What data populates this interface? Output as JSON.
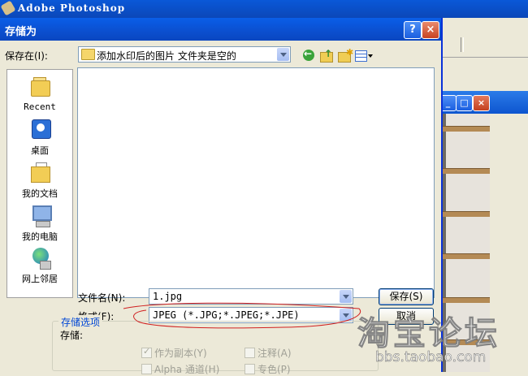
{
  "app": {
    "title": "Adobe Photoshop"
  },
  "dialog": {
    "title": "存储为",
    "help_glyph": "?",
    "close_glyph": "×",
    "save_in_label": "保存在(I):",
    "save_in_value": "添加水印后的图片        文件夹是空的",
    "places": [
      "Recent",
      "桌面",
      "我的文档",
      "我的电脑",
      "网上邻居"
    ],
    "filename_label": "文件名(N):",
    "filename_value": "1.jpg",
    "format_label": "格式(F):",
    "format_value": "JPEG (*.JPG;*.JPEG;*.JPE)",
    "save_button": "保存(S)",
    "cancel_button": "取消"
  },
  "options": {
    "group_title": "存储选项",
    "save_label": "存储:",
    "as_copy": "作为副本(Y)",
    "as_copy_checked": true,
    "annotations": "注释(A)",
    "annotations_checked": false,
    "alpha": "Alpha 通道(H)",
    "alpha_checked": false,
    "spot": "专色(P)",
    "spot_checked": false
  },
  "background_window": {
    "buttons": [
      "_",
      "□",
      "×"
    ]
  },
  "watermark": {
    "text": "淘宝论坛",
    "url": "bbs.taobao.com"
  },
  "colors": {
    "titlebar": "#0b4fcf",
    "dialog_bg": "#ece9d8",
    "annotation": "#d02020",
    "group_title": "#0046d5"
  }
}
